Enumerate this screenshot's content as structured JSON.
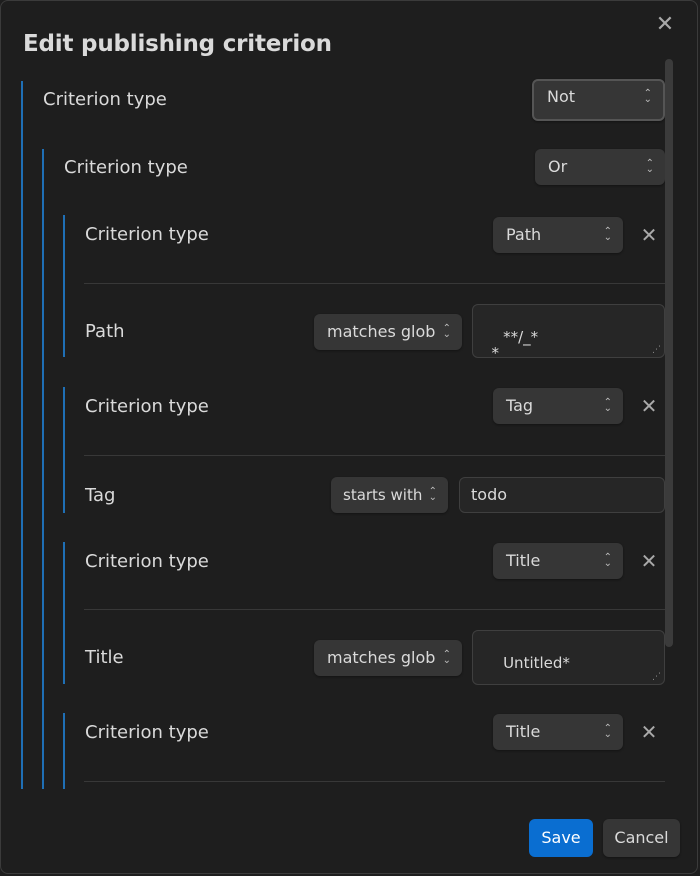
{
  "dialog": {
    "title": "Edit publishing criterion",
    "close_glyph": "✕",
    "remove_glyph": "✕",
    "chevron_glyph": "⌃⌄",
    "grip_glyph": "⋰"
  },
  "root": {
    "label": "Criterion type",
    "type_value": "Not"
  },
  "or_group": {
    "label": "Criterion type",
    "type_value": "Or"
  },
  "criteria": [
    {
      "type_label": "Criterion type",
      "type_value": "Path",
      "field_label": "Path",
      "operator": "matches glob",
      "value": "**/_*\n_*"
    },
    {
      "type_label": "Criterion type",
      "type_value": "Tag",
      "field_label": "Tag",
      "operator": "starts with",
      "value": "todo"
    },
    {
      "type_label": "Criterion type",
      "type_value": "Title",
      "field_label": "Title",
      "operator": "matches glob",
      "value": "Untitled*"
    },
    {
      "type_label": "Criterion type",
      "type_value": "Title"
    }
  ],
  "footer": {
    "save_label": "Save",
    "cancel_label": "Cancel"
  },
  "colors": {
    "background": "#1e1e1e",
    "accent": "#0a6ed1",
    "nest_line": "#1f6fb5",
    "text": "#dadada"
  }
}
